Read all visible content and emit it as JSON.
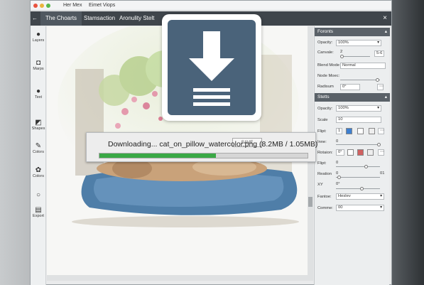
{
  "window": {
    "title_left": "Her Mex",
    "title_right": "Eimet Viops",
    "close_label": "×",
    "back_label": "←"
  },
  "tabs": [
    {
      "label": "The Choarts"
    },
    {
      "label": "Stamsaction"
    },
    {
      "label": "Aronulity Stelt"
    }
  ],
  "tools": [
    {
      "label": "Layers",
      "icon": "person-icon"
    },
    {
      "label": "Marps",
      "icon": "camera-icon"
    },
    {
      "label": "Text",
      "icon": "person-icon"
    },
    {
      "label": "Shapes",
      "icon": "shapes-icon"
    },
    {
      "label": "Colors",
      "icon": "brush-icon"
    },
    {
      "label": "Colors",
      "icon": "palette-icon"
    },
    {
      "label": "",
      "icon": "circle-icon"
    },
    {
      "label": "Export",
      "icon": "export-icon"
    }
  ],
  "panel": {
    "section1": {
      "title": "Foronts",
      "opacity_label": "Opacity:",
      "opacity_value": "100%",
      "canvas_label": "Canvale:",
      "canvas_min": "2",
      "canvas_max": "5-6",
      "blend_label": "Blend Mode",
      "blend_value": "Normal",
      "node_label": "Node Moec:",
      "radius_label": "Radisum",
      "radius_value": "0°"
    },
    "section2": {
      "title": "Stetts",
      "opacity_label": "Opacity:",
      "opacity_value": "100%",
      "scale_label": "Scale",
      "scale_value": "10",
      "flip_label": "Flipt:",
      "flip_value": "1",
      "inner_label": "Inne:",
      "inner_value": "0",
      "rotation_label": "Rotaion:",
      "rotation_value": "0°",
      "flip2_label": "Flipt:",
      "flip2_value": "0",
      "reaction_label": "Reation",
      "reaction_min": "0",
      "reaction_max": "01",
      "xy_label": "XY",
      "xy_value": "0°",
      "fantoe_label": "Fantoe:",
      "fantoe_value": "Heslev",
      "comme_label": "Comme:",
      "comme_value": "00"
    }
  },
  "download": {
    "text": "Downloading... cat_on_pillow_watercolor.png (8.2MB / 1.05MB)",
    "progress": 0.56,
    "save_label": "SAVE"
  },
  "colors": {
    "accent_dark": "#3f454b",
    "progress_green": "#3aa845",
    "download_icon_bg": "#4a637a",
    "swatch_blue": "#3d7fd0",
    "swatch_red": "#d06060"
  }
}
